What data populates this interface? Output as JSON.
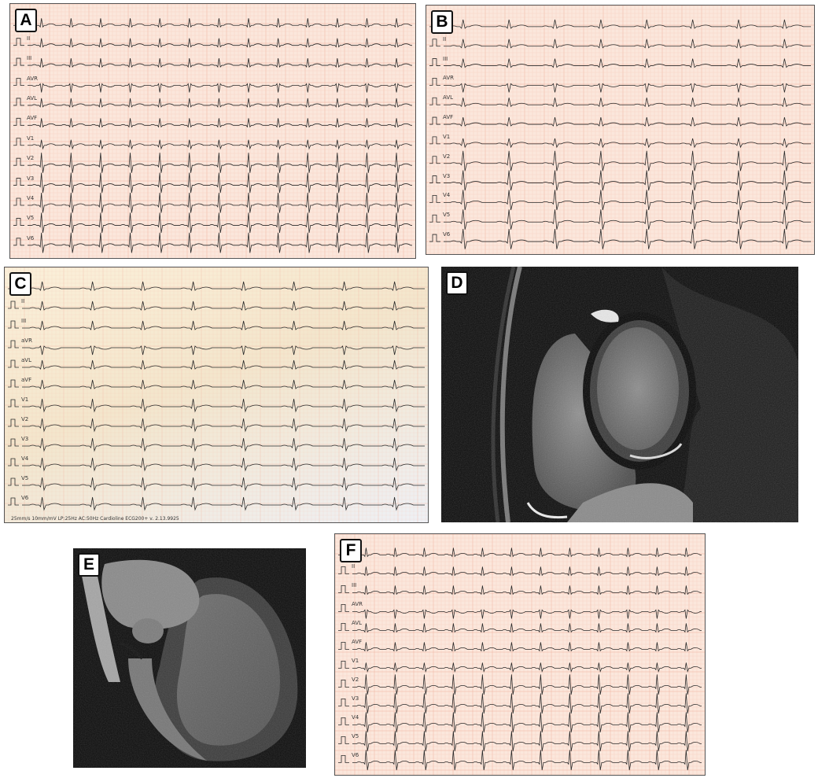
{
  "panels": [
    {
      "id": "A",
      "kind": "ecg",
      "paper": "#fbe7dc",
      "heart_rate": 13,
      "leads": [
        "I",
        "II",
        "III",
        "AVR",
        "AVL",
        "AVF",
        "V1",
        "V2",
        "V3",
        "V4",
        "V5",
        "V6"
      ]
    },
    {
      "id": "B",
      "kind": "ecg",
      "paper": "#fbe7dc",
      "heart_rate": 8,
      "leads": [
        "I",
        "II",
        "III",
        "AVR",
        "AVL",
        "AVF",
        "V1",
        "V2",
        "V3",
        "V4",
        "V5",
        "V6"
      ]
    },
    {
      "id": "C",
      "kind": "ecg",
      "paper": "#f6ead2",
      "heart_rate": 8,
      "leads": [
        "I",
        "II",
        "III",
        "aVR",
        "aVL",
        "aVF",
        "V1",
        "V2",
        "V3",
        "V4",
        "V5",
        "V6"
      ],
      "footer": "25mm/s  10mm/mV  LP:25Hz AC:50Hz   Cardioline ECG200+  v. 2.13.9925"
    },
    {
      "id": "D",
      "kind": "mri",
      "view": "short-axis"
    },
    {
      "id": "E",
      "kind": "mri",
      "view": "long-axis"
    },
    {
      "id": "F",
      "kind": "ecg",
      "paper": "#fbe7dc",
      "heart_rate": 12,
      "leads": [
        "I",
        "II",
        "III",
        "AVR",
        "AVL",
        "AVF",
        "V1",
        "V2",
        "V3",
        "V4",
        "V5",
        "V6"
      ]
    }
  ],
  "labels": {
    "A": "A",
    "B": "B",
    "C": "C",
    "D": "D",
    "E": "E",
    "F": "F"
  },
  "colors": {
    "grid": "#f2b9a6",
    "trace": "#2a2a2a",
    "mri_bg": "#0a0a0a"
  }
}
